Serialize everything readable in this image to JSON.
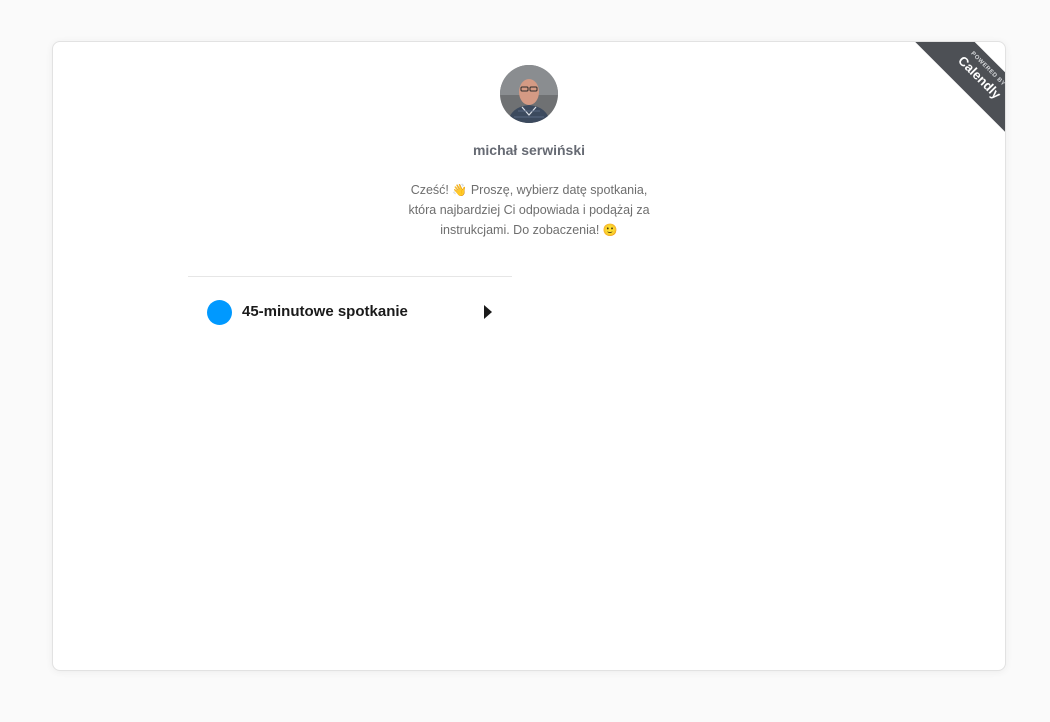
{
  "profile": {
    "name": "michał serwiński",
    "welcome_line1": "Cześć! ",
    "welcome_emoji1": "👋",
    "welcome_line1b": " Proszę, wybierz datę spotkania,",
    "welcome_line2": "która najbardziej Ci odpowiada i podążaj za",
    "welcome_line3": "instrukcjami. Do zobaczenia! ",
    "welcome_emoji2": "🙂"
  },
  "events": [
    {
      "label": "45-minutowe spotkanie",
      "color": "#0099ff"
    }
  ],
  "badge": {
    "small": "POWERED BY",
    "brand": "Calendly"
  }
}
